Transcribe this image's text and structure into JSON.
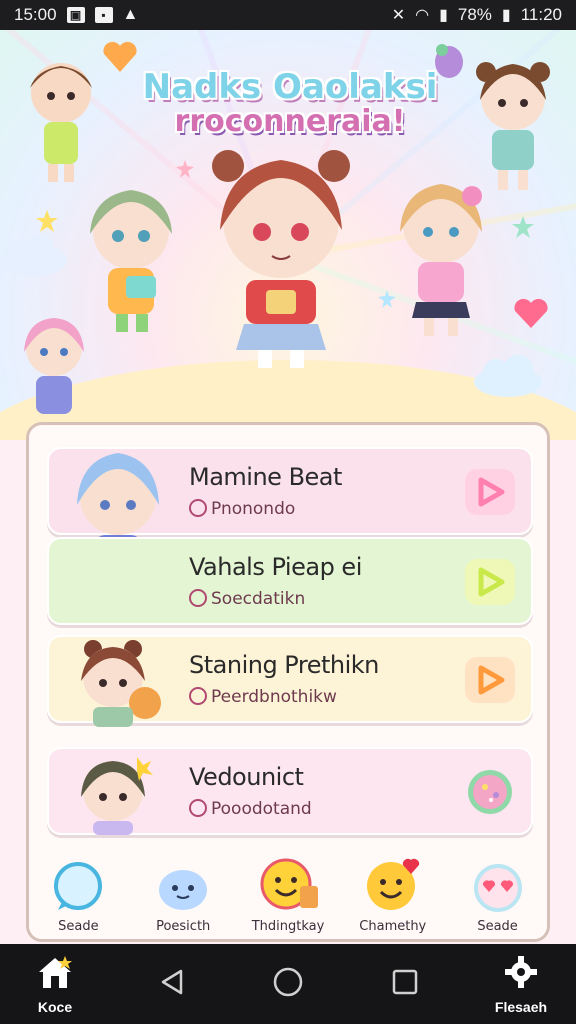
{
  "status_bar": {
    "time": "15:00",
    "battery": "78%",
    "clock_right": "11:20",
    "left_icons": [
      "image-icon",
      "notification-icon",
      "alert-icon"
    ],
    "right_icons": [
      "mute-icon",
      "wifi-icon",
      "signal-icon",
      "battery-icon"
    ]
  },
  "hero": {
    "title_line1": "Nadks Oaolaksi",
    "title_line2": "rroconneraia!"
  },
  "games": [
    {
      "title": "Mamine Beat",
      "subtitle": "Pnonondo",
      "color": "#fbe1ec",
      "button_color": "#ff7fae",
      "button_icon": "play-icon"
    },
    {
      "title": "Vahals Pieap ei",
      "subtitle": "Soecdatikn",
      "color": "#e3f5d2",
      "button_color": "#c9e94a",
      "button_icon": "play-icon"
    },
    {
      "title": "Staning Prethikn",
      "subtitle": "Peerdbnothikw",
      "color": "#fdf3d6",
      "button_color": "#ff9a3c",
      "button_icon": "play-icon"
    },
    {
      "title": "Vedounict",
      "subtitle": "Pooodotand",
      "color": "#fde6ef",
      "button_color": "#8fd8a8",
      "button_icon": "donut-icon"
    }
  ],
  "bottom_nav": [
    {
      "label": "Seade",
      "icon": "chat-bubble-icon"
    },
    {
      "label": "Poesicth",
      "icon": "slime-icon"
    },
    {
      "label": "Thdingtkay",
      "icon": "smiley-icon"
    },
    {
      "label": "Chamethy",
      "icon": "heart-face-icon"
    },
    {
      "label": "Seade",
      "icon": "heart-eyes-icon"
    }
  ],
  "system_nav": {
    "home_label": "Koce",
    "settings_label": "Flesaeh",
    "back_icon": "back-icon",
    "home_circle_icon": "home-circle-icon",
    "recents_icon": "recents-icon"
  },
  "colors": {
    "status_bg": "#1d1d1f",
    "panel_border": "#d6c0b8",
    "accent_pink": "#ff7fae"
  }
}
